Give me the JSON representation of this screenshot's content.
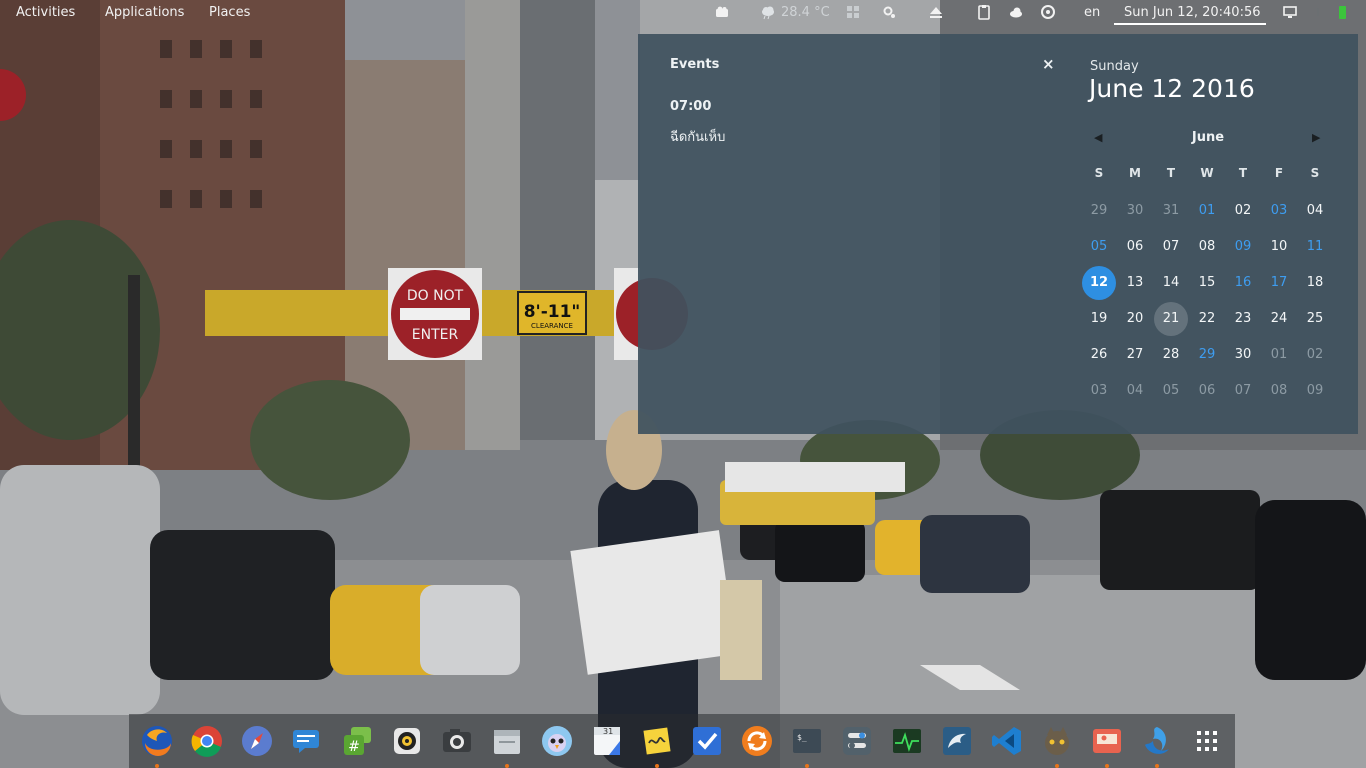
{
  "topbar": {
    "activities": "Activities",
    "applications": "Applications",
    "places": "Places",
    "weather": "28.4 °C",
    "language": "en",
    "clock": "Sun Jun 12, 20:40:56"
  },
  "events": {
    "title": "Events",
    "close_glyph": "×",
    "items": [
      {
        "time": "07:00",
        "description": "ฉีดกันเห็บ"
      }
    ]
  },
  "calendar": {
    "weekday": "Sunday",
    "full_date": "June 12 2016",
    "month": "June",
    "prev_glyph": "◀",
    "next_glyph": "▶",
    "day_headers": [
      "S",
      "M",
      "T",
      "W",
      "T",
      "F",
      "S"
    ],
    "weeks": [
      [
        {
          "d": "29",
          "s": "other"
        },
        {
          "d": "30",
          "s": "other"
        },
        {
          "d": "31",
          "s": "other"
        },
        {
          "d": "01",
          "s": "event"
        },
        {
          "d": "02",
          "s": ""
        },
        {
          "d": "03",
          "s": "event"
        },
        {
          "d": "04",
          "s": ""
        }
      ],
      [
        {
          "d": "05",
          "s": "event"
        },
        {
          "d": "06",
          "s": ""
        },
        {
          "d": "07",
          "s": ""
        },
        {
          "d": "08",
          "s": ""
        },
        {
          "d": "09",
          "s": "event"
        },
        {
          "d": "10",
          "s": ""
        },
        {
          "d": "11",
          "s": "event"
        }
      ],
      [
        {
          "d": "12",
          "s": "today"
        },
        {
          "d": "13",
          "s": ""
        },
        {
          "d": "14",
          "s": ""
        },
        {
          "d": "15",
          "s": ""
        },
        {
          "d": "16",
          "s": "event"
        },
        {
          "d": "17",
          "s": "event"
        },
        {
          "d": "18",
          "s": ""
        }
      ],
      [
        {
          "d": "19",
          "s": ""
        },
        {
          "d": "20",
          "s": ""
        },
        {
          "d": "21",
          "s": "hover"
        },
        {
          "d": "22",
          "s": ""
        },
        {
          "d": "23",
          "s": ""
        },
        {
          "d": "24",
          "s": ""
        },
        {
          "d": "25",
          "s": ""
        }
      ],
      [
        {
          "d": "26",
          "s": ""
        },
        {
          "d": "27",
          "s": ""
        },
        {
          "d": "28",
          "s": ""
        },
        {
          "d": "29",
          "s": "event"
        },
        {
          "d": "30",
          "s": ""
        },
        {
          "d": "01",
          "s": "other"
        },
        {
          "d": "02",
          "s": "other"
        }
      ],
      [
        {
          "d": "03",
          "s": "other"
        },
        {
          "d": "04",
          "s": "other"
        },
        {
          "d": "05",
          "s": "other"
        },
        {
          "d": "06",
          "s": "other"
        },
        {
          "d": "07",
          "s": "other"
        },
        {
          "d": "08",
          "s": "other"
        },
        {
          "d": "09",
          "s": "other"
        }
      ]
    ]
  },
  "colors": {
    "popover_bg": "#40525f",
    "event_day": "#3e9df0",
    "today": "#2e8fe2",
    "running_indicator": "#e7731a"
  },
  "dock": {
    "apps": [
      {
        "icon": "firefox-icon",
        "running": true
      },
      {
        "icon": "chrome-icon",
        "running": false
      },
      {
        "icon": "compass-browser-icon",
        "running": false
      },
      {
        "icon": "chat-messages-icon",
        "running": false
      },
      {
        "icon": "hashtag-chat-icon",
        "running": false
      },
      {
        "icon": "music-player-icon",
        "running": false
      },
      {
        "icon": "camera-icon",
        "running": false
      },
      {
        "icon": "files-icon",
        "running": true
      },
      {
        "icon": "bird-social-icon",
        "running": false
      },
      {
        "icon": "calendar-app-icon",
        "running": false
      },
      {
        "icon": "sticky-notes-icon",
        "running": true
      },
      {
        "icon": "tasks-check-icon",
        "running": false
      },
      {
        "icon": "update-sync-icon",
        "running": false
      },
      {
        "icon": "terminal-icon",
        "running": true
      },
      {
        "icon": "settings-toggles-icon",
        "running": false
      },
      {
        "icon": "system-monitor-icon",
        "running": false
      },
      {
        "icon": "database-dolphin-icon",
        "running": false
      },
      {
        "icon": "code-editor-icon",
        "running": false
      },
      {
        "icon": "image-editor-icon",
        "running": true
      },
      {
        "icon": "screenshot-icon",
        "running": true
      },
      {
        "icon": "app-store-swirl-icon",
        "running": true
      },
      {
        "icon": "app-grid-icon",
        "running": false
      }
    ]
  }
}
